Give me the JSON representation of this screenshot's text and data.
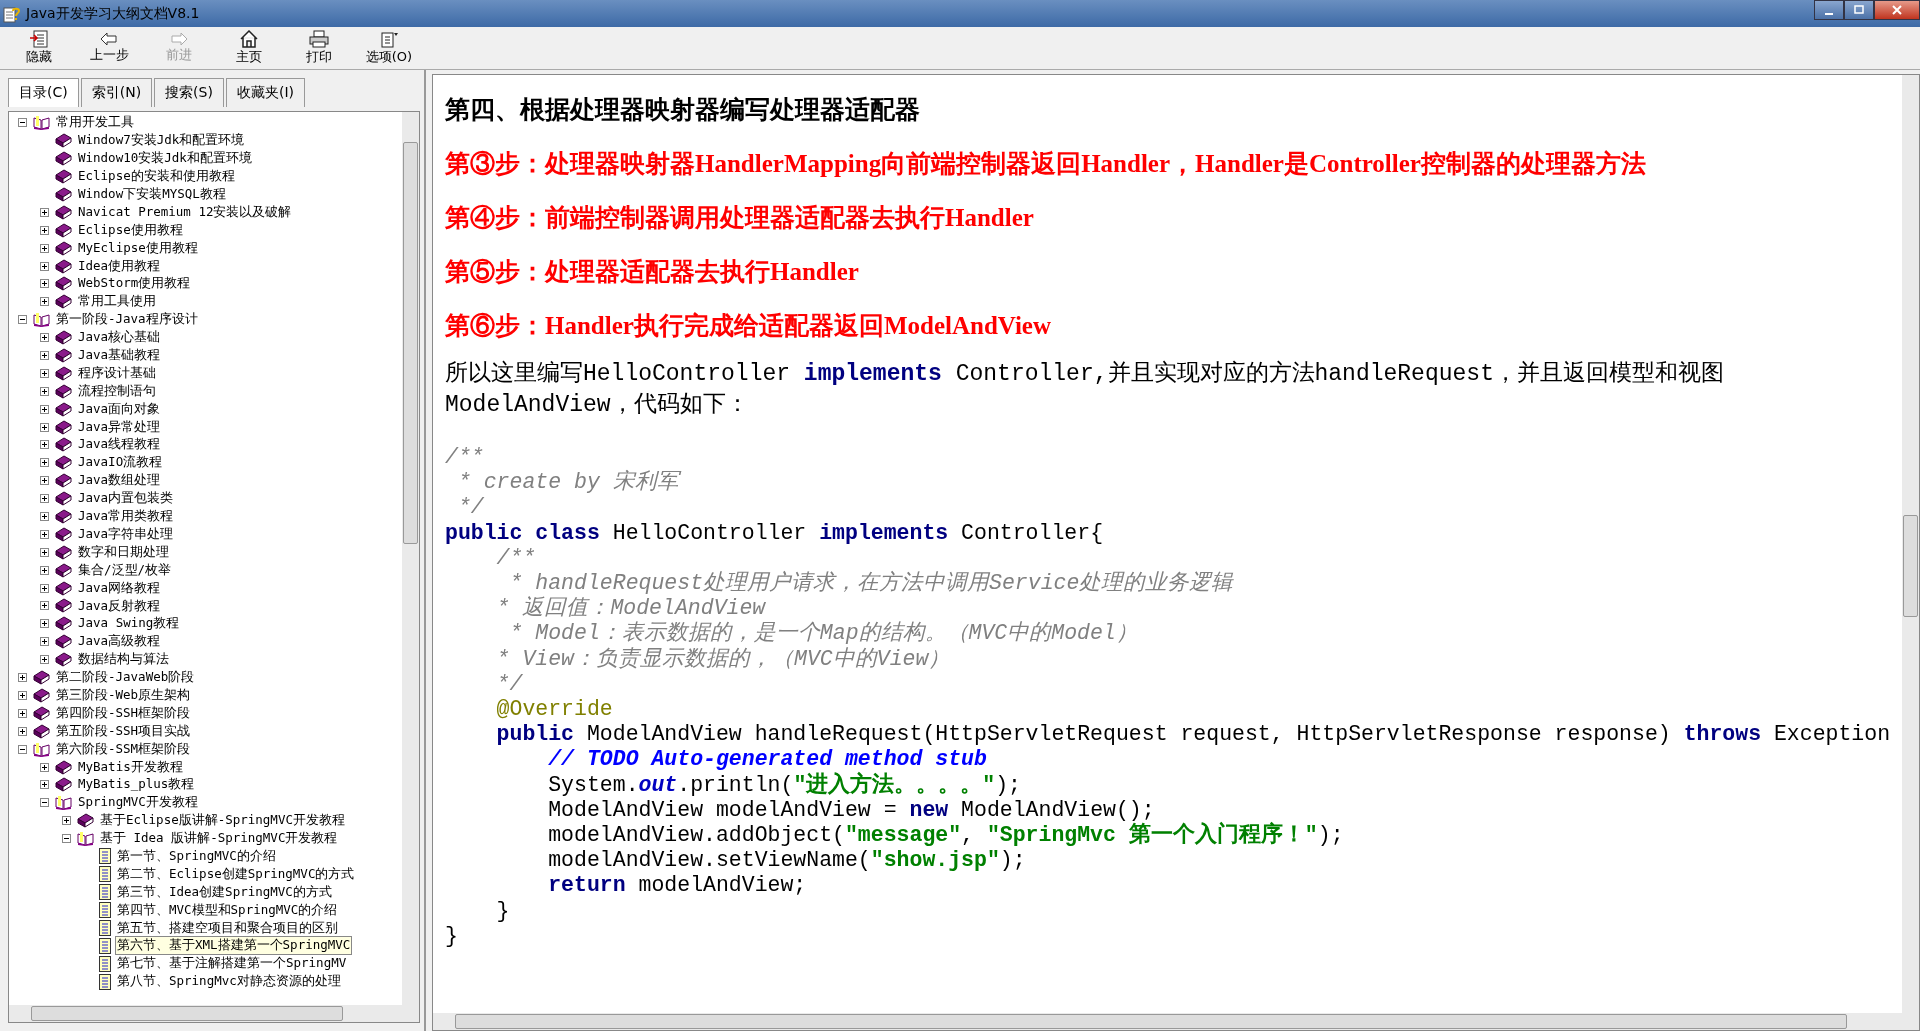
{
  "window": {
    "title": "Java开发学习大纲文档V8.1"
  },
  "toolbar": [
    {
      "label": "隐藏",
      "kind": "hide",
      "disabled": false
    },
    {
      "label": "上一步",
      "kind": "back",
      "disabled": false
    },
    {
      "label": "前进",
      "kind": "forward",
      "disabled": true
    },
    {
      "label": "主页",
      "kind": "home",
      "disabled": false
    },
    {
      "label": "打印",
      "kind": "print",
      "disabled": false
    },
    {
      "label": "选项(O)",
      "kind": "options",
      "disabled": false
    }
  ],
  "tabs": [
    {
      "label": "目录(C)",
      "selected": true
    },
    {
      "label": "索引(N)",
      "selected": false
    },
    {
      "label": "搜索(S)",
      "selected": false
    },
    {
      "label": "收藏夹(I)",
      "selected": false
    }
  ],
  "tree": [
    {
      "label": "常用开发工具",
      "kind": "folder",
      "expanded": true,
      "selected": false,
      "children": [
        {
          "label": "Window7安装Jdk和配置环境",
          "kind": "book",
          "selected": false
        },
        {
          "label": "Window10安装Jdk和配置环境",
          "kind": "book",
          "selected": false
        },
        {
          "label": "Eclipse的安装和使用教程",
          "kind": "book",
          "selected": false
        },
        {
          "label": "Window下安装MYSQL教程",
          "kind": "book",
          "selected": false
        },
        {
          "label": "Navicat Premium 12安装以及破解",
          "kind": "folder",
          "expanded": false,
          "selected": false
        },
        {
          "label": "Eclipse使用教程",
          "kind": "folder",
          "expanded": false,
          "selected": false
        },
        {
          "label": "MyEclipse使用教程",
          "kind": "folder",
          "expanded": false,
          "selected": false
        },
        {
          "label": "Idea使用教程",
          "kind": "folder",
          "expanded": false,
          "selected": false
        },
        {
          "label": "WebStorm使用教程",
          "kind": "folder",
          "expanded": false,
          "selected": false
        },
        {
          "label": "常用工具使用",
          "kind": "folder",
          "expanded": false,
          "selected": false
        }
      ]
    },
    {
      "label": "第一阶段-Java程序设计",
      "kind": "folder",
      "expanded": true,
      "selected": false,
      "children": [
        {
          "label": "Java核心基础",
          "kind": "folder",
          "expanded": false,
          "selected": false
        },
        {
          "label": "Java基础教程",
          "kind": "folder",
          "expanded": false,
          "selected": false
        },
        {
          "label": "程序设计基础",
          "kind": "folder",
          "expanded": false,
          "selected": false
        },
        {
          "label": "流程控制语句",
          "kind": "folder",
          "expanded": false,
          "selected": false
        },
        {
          "label": "Java面向对象",
          "kind": "folder",
          "expanded": false,
          "selected": false
        },
        {
          "label": "Java异常处理",
          "kind": "folder",
          "expanded": false,
          "selected": false
        },
        {
          "label": "Java线程教程",
          "kind": "folder",
          "expanded": false,
          "selected": false
        },
        {
          "label": "JavaIO流教程",
          "kind": "folder",
          "expanded": false,
          "selected": false
        },
        {
          "label": "Java数组处理",
          "kind": "folder",
          "expanded": false,
          "selected": false
        },
        {
          "label": "Java内置包装类",
          "kind": "folder",
          "expanded": false,
          "selected": false
        },
        {
          "label": "Java常用类教程",
          "kind": "folder",
          "expanded": false,
          "selected": false
        },
        {
          "label": "Java字符串处理",
          "kind": "folder",
          "expanded": false,
          "selected": false
        },
        {
          "label": "数字和日期处理",
          "kind": "folder",
          "expanded": false,
          "selected": false
        },
        {
          "label": "集合/泛型/枚举",
          "kind": "folder",
          "expanded": false,
          "selected": false
        },
        {
          "label": "Java网络教程",
          "kind": "folder",
          "expanded": false,
          "selected": false
        },
        {
          "label": "Java反射教程",
          "kind": "folder",
          "expanded": false,
          "selected": false
        },
        {
          "label": "Java Swing教程",
          "kind": "folder",
          "expanded": false,
          "selected": false
        },
        {
          "label": "Java高级教程",
          "kind": "folder",
          "expanded": false,
          "selected": false
        },
        {
          "label": "数据结构与算法",
          "kind": "folder",
          "expanded": false,
          "selected": false
        }
      ]
    },
    {
      "label": "第二阶段-JavaWeb阶段",
      "kind": "folder",
      "expanded": false,
      "selected": false
    },
    {
      "label": "第三阶段-Web原生架构",
      "kind": "folder",
      "expanded": false,
      "selected": false
    },
    {
      "label": "第四阶段-SSH框架阶段",
      "kind": "folder",
      "expanded": false,
      "selected": false
    },
    {
      "label": "第五阶段-SSH项目实战",
      "kind": "folder",
      "expanded": false,
      "selected": false
    },
    {
      "label": "第六阶段-SSM框架阶段",
      "kind": "folder",
      "expanded": true,
      "selected": false,
      "children": [
        {
          "label": "MyBatis开发教程",
          "kind": "folder",
          "expanded": false,
          "selected": false
        },
        {
          "label": "MyBatis_plus教程",
          "kind": "folder",
          "expanded": false,
          "selected": false
        },
        {
          "label": "SpringMVC开发教程",
          "kind": "folder",
          "expanded": true,
          "selected": false,
          "children": [
            {
              "label": "基于Eclipse版讲解-SpringMVC开发教程",
              "kind": "folder",
              "expanded": false,
              "selected": false
            },
            {
              "label": "基于  Idea 版讲解-SpringMVC开发教程",
              "kind": "folder",
              "expanded": true,
              "selected": false,
              "children": [
                {
                  "label": "第一节、SpringMVC的介绍",
                  "kind": "page",
                  "selected": false
                },
                {
                  "label": "第二节、Eclipse创建SpringMVC的方式",
                  "kind": "page",
                  "selected": false
                },
                {
                  "label": "第三节、Idea创建SpringMVC的方式",
                  "kind": "page",
                  "selected": false
                },
                {
                  "label": "第四节、MVC模型和SpringMVC的介绍",
                  "kind": "page",
                  "selected": false
                },
                {
                  "label": "第五节、搭建空项目和聚合项目的区别",
                  "kind": "page",
                  "selected": false
                },
                {
                  "label": "第六节、基于XML搭建第一个SpringMVC",
                  "kind": "page",
                  "selected": true
                },
                {
                  "label": "第七节、基于注解搭建第一个SpringMV",
                  "kind": "page",
                  "selected": false
                },
                {
                  "label": "第八节、SpringMvc对静态资源的处理",
                  "kind": "page",
                  "selected": false
                }
              ]
            }
          ]
        }
      ]
    }
  ],
  "content": {
    "heading": "第四、根据处理器映射器编写处理器适配器",
    "steps": [
      "第③步：处理器映射器HandlerMapping向前端控制器返回Handler，Handler是Controller控制器的处理器方法",
      "第④步：前端控制器调用处理器适配器去执行Handler",
      "第⑤步：处理器适配器去执行Handler",
      "第⑥步：Handler执行完成给适配器返回ModelAndView"
    ],
    "paragraph": "所以这里编写HelloController **implements** Controller,并且实现对应的方法handleRequest，并且返回模型和视图ModelAndView，代码如下：",
    "code": [
      [
        {
          "kind": "comment",
          "text": "/**"
        }
      ],
      [
        {
          "kind": "comment",
          "text": " * create by 宋利军"
        }
      ],
      [
        {
          "kind": "comment",
          "text": " */"
        }
      ],
      [
        {
          "kind": "keyword",
          "text": "public class"
        },
        {
          "kind": "plain",
          "text": " HelloController "
        },
        {
          "kind": "keyword",
          "text": "implements"
        },
        {
          "kind": "plain",
          "text": " Controller{"
        }
      ],
      [
        {
          "kind": "comment",
          "text": "    /**"
        }
      ],
      [
        {
          "kind": "comment",
          "text": "     * handleRequest处理用户请求，在方法中调用Service处理的业务逻辑"
        }
      ],
      [
        {
          "kind": "comment",
          "text": "    * 返回值：ModelAndView"
        }
      ],
      [
        {
          "kind": "comment",
          "text": "     * Model：表示数据的，是一个Map的结构。（MVC中的Model）"
        }
      ],
      [
        {
          "kind": "comment",
          "text": "    * View：负责显示数据的，（MVC中的View）"
        }
      ],
      [
        {
          "kind": "comment",
          "text": "    */"
        }
      ],
      [
        {
          "kind": "annotation",
          "text": "    @Override"
        }
      ],
      [
        {
          "kind": "keyword",
          "text": "    public"
        },
        {
          "kind": "plain",
          "text": " ModelAndView handleRequest(HttpServletRequest request, HttpServletResponse response) "
        },
        {
          "kind": "keyword",
          "text": "throws"
        },
        {
          "kind": "plain",
          "text": " Exception"
        }
      ],
      [
        {
          "kind": "todo",
          "text": "        // TODO Auto-generated method stub"
        }
      ],
      [
        {
          "kind": "plain",
          "text": "        System."
        },
        {
          "kind": "static",
          "text": "out"
        },
        {
          "kind": "plain",
          "text": ".println("
        },
        {
          "kind": "string",
          "text": "\"进入方法。。。。\""
        },
        {
          "kind": "plain",
          "text": ");"
        }
      ],
      [
        {
          "kind": "plain",
          "text": "        ModelAndView modelAndView = "
        },
        {
          "kind": "keyword",
          "text": "new"
        },
        {
          "kind": "plain",
          "text": " ModelAndView();"
        }
      ],
      [
        {
          "kind": "plain",
          "text": "        modelAndView.addObject("
        },
        {
          "kind": "string",
          "text": "\"message\""
        },
        {
          "kind": "plain",
          "text": ", "
        },
        {
          "kind": "string",
          "text": "\"SpringMvc 第一个入门程序！\""
        },
        {
          "kind": "plain",
          "text": ");"
        }
      ],
      [
        {
          "kind": "plain",
          "text": "        modelAndView.setViewName("
        },
        {
          "kind": "string",
          "text": "\"show.jsp\""
        },
        {
          "kind": "plain",
          "text": ");"
        }
      ],
      [
        {
          "kind": "keyword",
          "text": "        return"
        },
        {
          "kind": "plain",
          "text": " modelAndView;"
        }
      ],
      [
        {
          "kind": "plain",
          "text": "    }"
        }
      ],
      [
        {
          "kind": "plain",
          "text": "}"
        }
      ]
    ]
  }
}
